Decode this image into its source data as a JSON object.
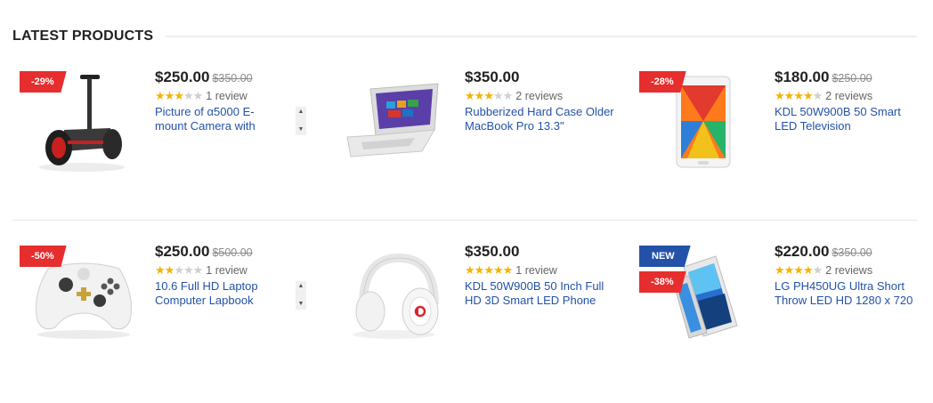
{
  "section": {
    "title": "LATEST PRODUCTS"
  },
  "products": [
    {
      "badge": "-29%",
      "new_label": "",
      "price": "$250.00",
      "old_price": "$350.00",
      "stars": 3,
      "reviews": "1 review",
      "title": "Picture of α5000 E-mount Camera with",
      "image": "self-balancing-scooter-image",
      "scrollable": true
    },
    {
      "badge": "",
      "new_label": "",
      "price": "$350.00",
      "old_price": "",
      "stars": 3,
      "reviews": "2 reviews",
      "title": "Rubberized Hard Case Older MacBook Pro 13.3\"",
      "image": "laptop-image",
      "scrollable": false
    },
    {
      "badge": "-28%",
      "new_label": "",
      "price": "$180.00",
      "old_price": "$250.00",
      "stars": 4,
      "reviews": "2 reviews",
      "title": "KDL 50W900B 50 Smart LED Television",
      "image": "tablet-image",
      "scrollable": false
    },
    {
      "badge": "-50%",
      "new_label": "",
      "price": "$250.00",
      "old_price": "$500.00",
      "stars": 2,
      "reviews": "1 review",
      "title": "10.6 Full HD Laptop Computer Lapbook",
      "image": "game-controller-image",
      "scrollable": true
    },
    {
      "badge": "",
      "new_label": "",
      "price": "$350.00",
      "old_price": "",
      "stars": 5,
      "reviews": "1 review",
      "title": "KDL 50W900B 50 Inch Full HD 3D Smart LED Phone",
      "image": "headphones-image",
      "scrollable": false
    },
    {
      "badge": "-38%",
      "new_label": "NEW",
      "price": "$220.00",
      "old_price": "$350.00",
      "stars": 4,
      "reviews": "2 reviews",
      "title": "LG PH450UG Ultra Short Throw LED HD 1280 x 720",
      "image": "smartphone-image",
      "scrollable": false
    }
  ],
  "colors": {
    "sale_badge": "#e62e2e",
    "new_badge": "#2352a8",
    "link": "#2352a8",
    "star": "#f5b301"
  }
}
